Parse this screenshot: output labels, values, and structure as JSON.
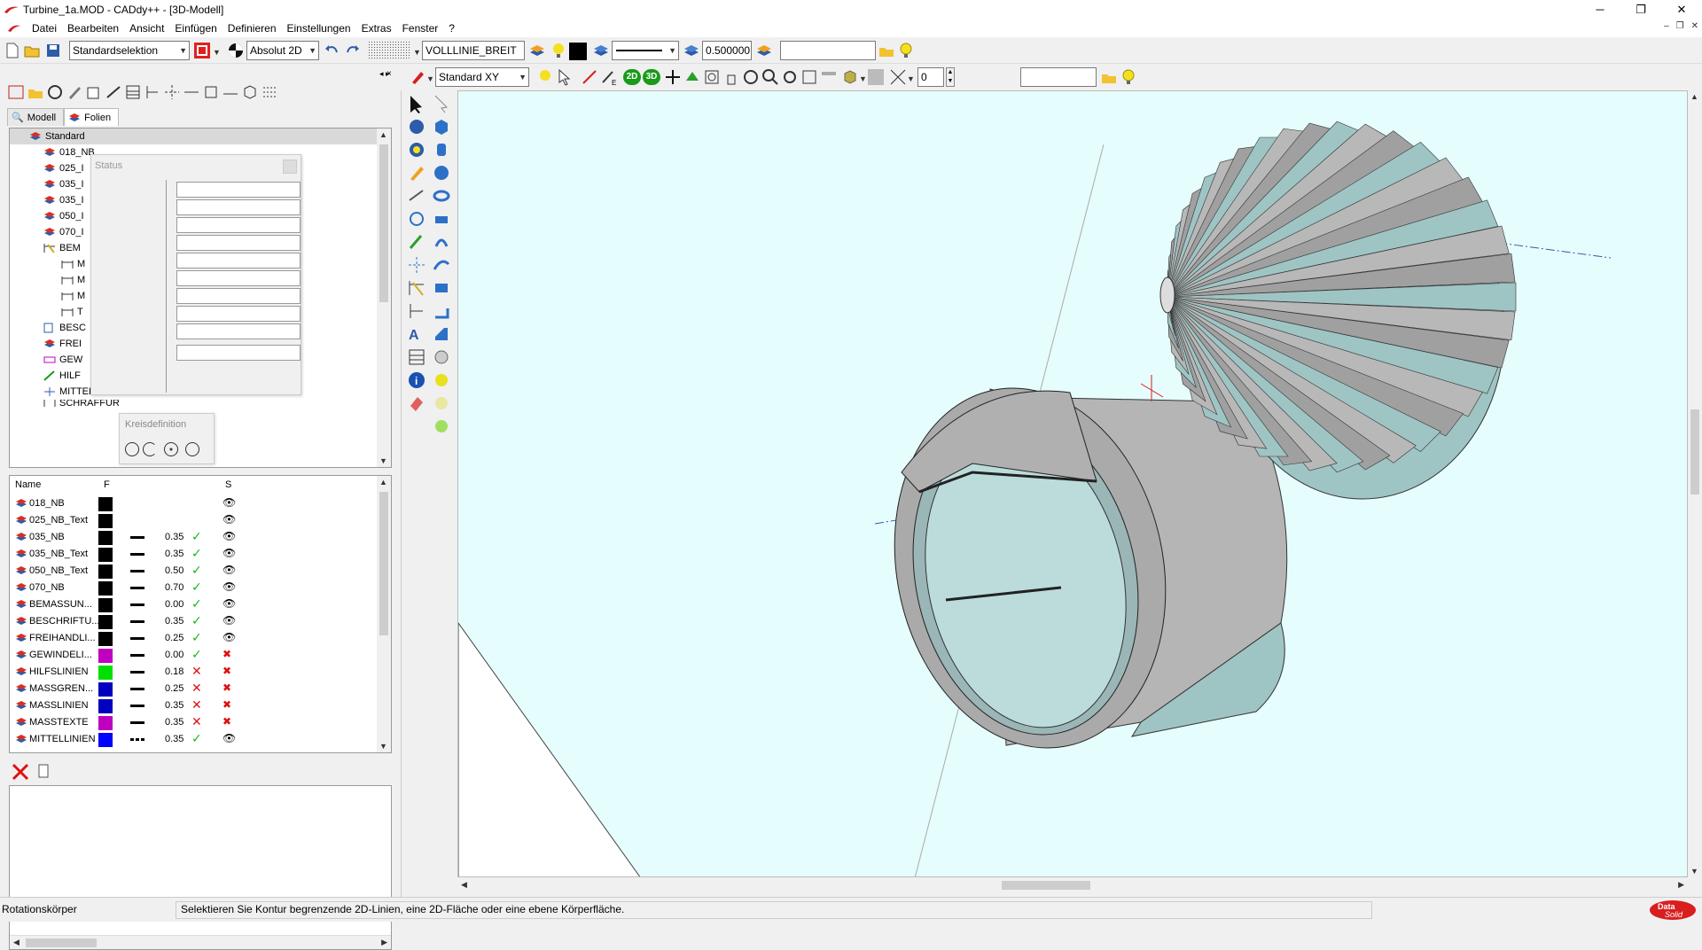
{
  "window": {
    "title": "Turbine_1a.MOD  -  CADdy++ - [3D-Modell]",
    "controls": [
      "─",
      "❐",
      "✕"
    ],
    "mdi_controls": [
      "–",
      "❐",
      "✕"
    ]
  },
  "menu": {
    "items": [
      "Datei",
      "Bearbeiten",
      "Ansicht",
      "Einfügen",
      "Definieren",
      "Einstellungen",
      "Extras",
      "Fenster",
      "?"
    ]
  },
  "toolbar1": {
    "selection_mode": "Standardselektion",
    "coord_mode": "Absolut 2D",
    "line_type": "VOLLLINIE_BREIT",
    "line_width": "0.500000",
    "search_value": ""
  },
  "toolbar2": {
    "view": "Standard XY",
    "level": "0",
    "search_value": ""
  },
  "tabs": [
    "Modell",
    "Folien"
  ],
  "tree": {
    "root": "Standard",
    "items": [
      "018_NB",
      "025_I",
      "035_I",
      "035_I",
      "050_I",
      "070_I",
      "BEM",
      "M",
      "M",
      "M",
      "T",
      "BESC",
      "FREI",
      "GEW",
      "HILF",
      "MITTELLINIEN",
      "SCHRAFFUR"
    ]
  },
  "status_popup": {
    "title": "Status"
  },
  "kreis_popup": {
    "title": "Kreisdefinition"
  },
  "layer_table": {
    "columns": [
      "Name",
      "F",
      "S"
    ],
    "rows": [
      {
        "name": "018_NB",
        "color": "#000000",
        "width": "",
        "visible": "",
        "eye": "open"
      },
      {
        "name": "025_NB_Text",
        "color": "#000000",
        "width": "",
        "visible": "",
        "eye": "open"
      },
      {
        "name": "035_NB",
        "color": "#000000",
        "width": "0.35",
        "visible": "yes",
        "eye": "open"
      },
      {
        "name": "035_NB_Text",
        "color": "#000000",
        "width": "0.35",
        "visible": "yes",
        "eye": "open"
      },
      {
        "name": "050_NB_Text",
        "color": "#000000",
        "width": "0.50",
        "visible": "yes",
        "eye": "open"
      },
      {
        "name": "070_NB",
        "color": "#000000",
        "width": "0.70",
        "visible": "yes",
        "eye": "open"
      },
      {
        "name": "BEMASSUN...",
        "color": "#000000",
        "width": "0.00",
        "visible": "yes",
        "eye": "open"
      },
      {
        "name": "BESCHRIFTU...",
        "color": "#000000",
        "width": "0.35",
        "visible": "yes",
        "eye": "open"
      },
      {
        "name": "FREIHANDLI...",
        "color": "#000000",
        "width": "0.25",
        "visible": "yes",
        "eye": "open"
      },
      {
        "name": "GEWINDELI...",
        "color": "#c000c0",
        "width": "0.00",
        "visible": "yes",
        "eye": "hidden"
      },
      {
        "name": "HILFSLINIEN",
        "color": "#00e000",
        "width": "0.18",
        "visible": "no",
        "eye": "hidden"
      },
      {
        "name": "MASSGREN...",
        "color": "#0000c0",
        "width": "0.25",
        "visible": "no",
        "eye": "hidden"
      },
      {
        "name": "MASSLINIEN",
        "color": "#0000c0",
        "width": "0.35",
        "visible": "no",
        "eye": "hidden"
      },
      {
        "name": "MASSTEXTE",
        "color": "#c000c0",
        "width": "0.35",
        "visible": "no",
        "eye": "hidden"
      },
      {
        "name": "MITTELLINIEN",
        "color": "#0000ff",
        "width": "0.35",
        "visible": "yes",
        "eye": "open"
      }
    ]
  },
  "statusbar": {
    "command": "Rotationskörper",
    "prompt": "Selektieren Sie Kontur begrenzende 2D-Linien, eine 2D-Fläche oder eine ebene Körperfläche."
  },
  "brand": {
    "text_top": "Data",
    "text_bottom": "Solid",
    "color": "#d81e1e"
  },
  "colors": {
    "viewport_bg": "#e6fdfd",
    "accent_red": "#d81e1e"
  }
}
